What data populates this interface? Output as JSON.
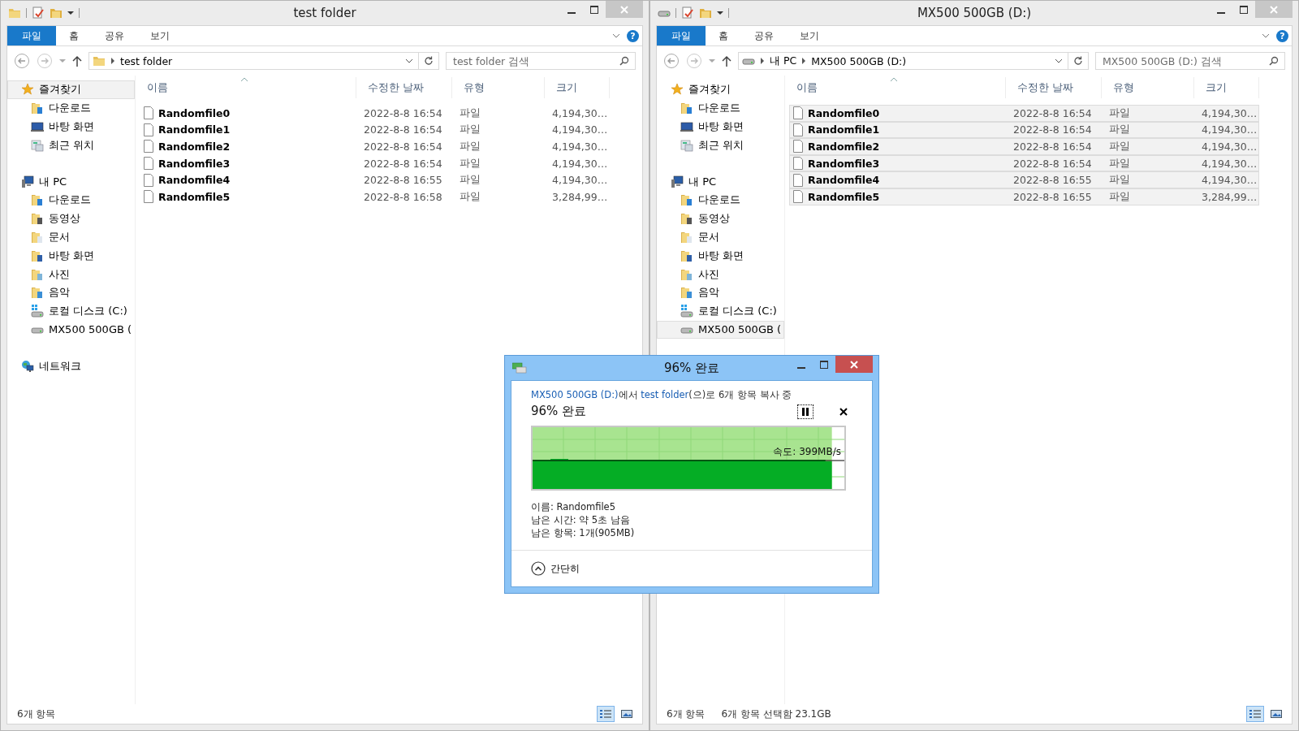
{
  "windows": [
    {
      "title": "test folder",
      "kind": "folder",
      "ribbon_tabs": [
        {
          "label": "파일",
          "selected": true
        },
        {
          "label": "홈",
          "selected": false
        },
        {
          "label": "공유",
          "selected": false
        },
        {
          "label": "보기",
          "selected": false
        }
      ],
      "help": "?",
      "address": [
        "test folder"
      ],
      "search": {
        "placeholder": "test folder 검색"
      },
      "sidebar": [
        {
          "label": "즐겨찾기",
          "kind": "star",
          "selected": true,
          "children": [
            {
              "label": "다운로드",
              "kind": "downloads",
              "selected": false
            },
            {
              "label": "바탕 화면",
              "kind": "desktop",
              "selected": false
            },
            {
              "label": "최근 위치",
              "kind": "recent",
              "selected": false
            }
          ]
        },
        {
          "label": "내 PC",
          "kind": "pc",
          "selected": false,
          "children": [
            {
              "label": "다운로드",
              "kind": "downloads",
              "selected": false
            },
            {
              "label": "동영상",
              "kind": "videos",
              "selected": false
            },
            {
              "label": "문서",
              "kind": "documents",
              "selected": false
            },
            {
              "label": "바탕 화면",
              "kind": "desktop-folder",
              "selected": false
            },
            {
              "label": "사진",
              "kind": "pictures",
              "selected": false
            },
            {
              "label": "음악",
              "kind": "music",
              "selected": false
            },
            {
              "label": "로컬 디스크 (C:)",
              "kind": "system-disk",
              "selected": false
            },
            {
              "label": "MX500 500GB (",
              "kind": "disk",
              "selected": false
            }
          ]
        },
        {
          "label": "네트워크",
          "kind": "network",
          "selected": false
        }
      ],
      "columns": [
        "이름",
        "수정한 날짜",
        "유형",
        "크기"
      ],
      "rows": [
        {
          "name": "Randomfile0",
          "modified": "2022-8-8 16:54",
          "type": "파일",
          "size": "4,194,30…",
          "selected": false
        },
        {
          "name": "Randomfile1",
          "modified": "2022-8-8 16:54",
          "type": "파일",
          "size": "4,194,30…",
          "selected": false
        },
        {
          "name": "Randomfile2",
          "modified": "2022-8-8 16:54",
          "type": "파일",
          "size": "4,194,30…",
          "selected": false
        },
        {
          "name": "Randomfile3",
          "modified": "2022-8-8 16:54",
          "type": "파일",
          "size": "4,194,30…",
          "selected": false
        },
        {
          "name": "Randomfile4",
          "modified": "2022-8-8 16:55",
          "type": "파일",
          "size": "4,194,30…",
          "selected": false
        },
        {
          "name": "Randomfile5",
          "modified": "2022-8-8 16:58",
          "type": "파일",
          "size": "3,284,99…",
          "selected": false
        }
      ],
      "status_bar": [
        "6개 항목"
      ],
      "views": [
        {
          "kind": "details",
          "selected": true
        },
        {
          "kind": "large-icons",
          "selected": false
        }
      ]
    },
    {
      "title": "MX500 500GB (D:)",
      "kind": "drive",
      "ribbon_tabs": [
        {
          "label": "파일",
          "selected": true
        },
        {
          "label": "홈",
          "selected": false
        },
        {
          "label": "공유",
          "selected": false
        },
        {
          "label": "보기",
          "selected": false
        }
      ],
      "help": "?",
      "address": [
        "내 PC",
        "MX500 500GB (D:)"
      ],
      "search": {
        "placeholder": "MX500 500GB (D:) 검색"
      },
      "sidebar": [
        {
          "label": "즐겨찾기",
          "kind": "star",
          "selected": false,
          "children": [
            {
              "label": "다운로드",
              "kind": "downloads",
              "selected": false
            },
            {
              "label": "바탕 화면",
              "kind": "desktop",
              "selected": false
            },
            {
              "label": "최근 위치",
              "kind": "recent",
              "selected": false
            }
          ]
        },
        {
          "label": "내 PC",
          "kind": "pc",
          "selected": false,
          "children": [
            {
              "label": "다운로드",
              "kind": "downloads",
              "selected": false
            },
            {
              "label": "동영상",
              "kind": "videos",
              "selected": false
            },
            {
              "label": "문서",
              "kind": "documents",
              "selected": false
            },
            {
              "label": "바탕 화면",
              "kind": "desktop-folder",
              "selected": false
            },
            {
              "label": "사진",
              "kind": "pictures",
              "selected": false
            },
            {
              "label": "음악",
              "kind": "music",
              "selected": false
            },
            {
              "label": "로컬 디스크 (C:)",
              "kind": "system-disk",
              "selected": false
            },
            {
              "label": "MX500 500GB (",
              "kind": "disk",
              "selected": true
            }
          ]
        }
      ],
      "columns": [
        "이름",
        "수정한 날짜",
        "유형",
        "크기"
      ],
      "rows": [
        {
          "name": "Randomfile0",
          "modified": "2022-8-8 16:54",
          "type": "파일",
          "size": "4,194,30…",
          "selected": true
        },
        {
          "name": "Randomfile1",
          "modified": "2022-8-8 16:54",
          "type": "파일",
          "size": "4,194,30…",
          "selected": true
        },
        {
          "name": "Randomfile2",
          "modified": "2022-8-8 16:54",
          "type": "파일",
          "size": "4,194,30…",
          "selected": true
        },
        {
          "name": "Randomfile3",
          "modified": "2022-8-8 16:54",
          "type": "파일",
          "size": "4,194,30…",
          "selected": true
        },
        {
          "name": "Randomfile4",
          "modified": "2022-8-8 16:55",
          "type": "파일",
          "size": "4,194,30…",
          "selected": true
        },
        {
          "name": "Randomfile5",
          "modified": "2022-8-8 16:55",
          "type": "파일",
          "size": "3,284,99…",
          "selected": true
        }
      ],
      "status_bar": [
        "6개 항목",
        "6개 항목 선택함 23.1GB"
      ],
      "views": [
        {
          "kind": "details",
          "selected": true
        },
        {
          "kind": "large-icons",
          "selected": false
        }
      ]
    }
  ],
  "dialog": {
    "title": "96% 완료",
    "description": [
      {
        "kind": "link",
        "text": "MX500 500GB (D:)"
      },
      {
        "kind": "text",
        "text": "에서 "
      },
      {
        "kind": "link",
        "text": "test folder"
      },
      {
        "kind": "text",
        "text": "(으)로 6개 항목 복사 중"
      }
    ],
    "heading": "96% 완료",
    "level": 0.96,
    "speed": "속도: 399MB/s",
    "details": [
      "이름: Randomfile5",
      "남은 시간: 약 5초 남음",
      "남은 항목: 1개(905MB)"
    ],
    "toggle": "간단히"
  }
}
